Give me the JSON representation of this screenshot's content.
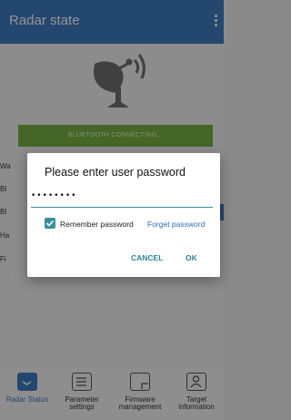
{
  "app": {
    "title": "Radar state"
  },
  "status": {
    "bluetooth_label": "BLUETOOTH CONNECTING..."
  },
  "background_rows": [
    "Wa",
    "Bl",
    "Bl",
    "Ha",
    "Fi"
  ],
  "tabs": [
    {
      "label": "Radar Status",
      "icon": "radar-status-icon",
      "active": true
    },
    {
      "label": "Parameter settings",
      "icon": "parameter-settings-icon",
      "active": false
    },
    {
      "label": "Firmware management",
      "icon": "firmware-icon",
      "active": false
    },
    {
      "label": "Target information",
      "icon": "target-info-icon",
      "active": false
    }
  ],
  "dialog": {
    "title": "Please enter user password",
    "password_value": "••••••••",
    "remember_label": "Remember password",
    "remember_checked": true,
    "forget_label": "Forget password",
    "cancel_label": "CANCEL",
    "ok_label": "OK"
  },
  "colors": {
    "appbar": "#3f7bc2",
    "status_bar": "#78b043",
    "dialog_accent": "#3a8f9d",
    "link": "#2e6fb8"
  }
}
